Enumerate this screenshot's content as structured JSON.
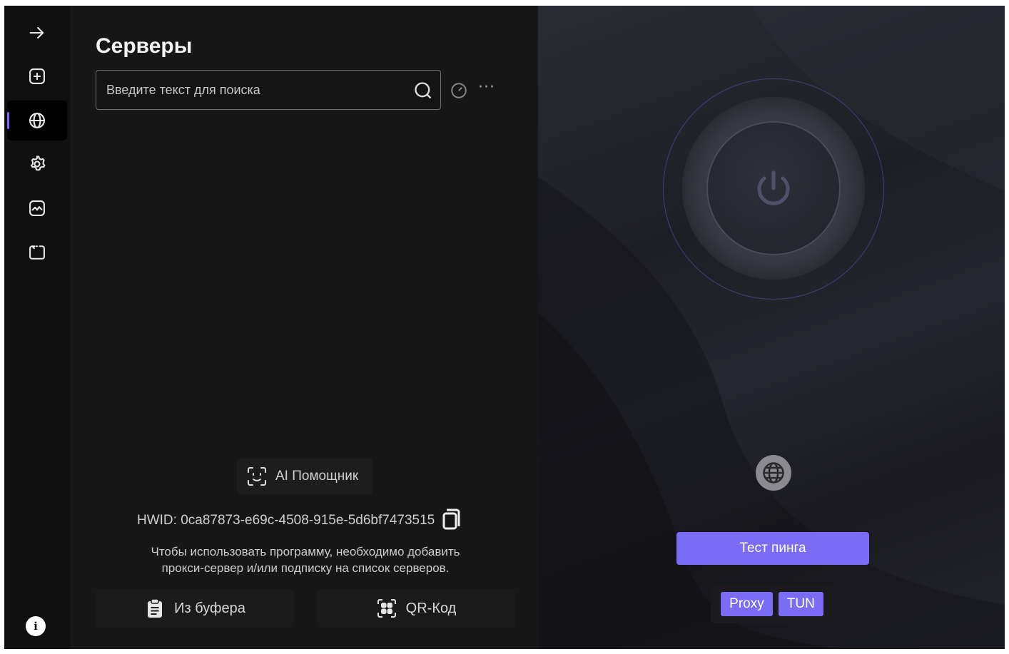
{
  "sidebar": {
    "items": [
      {
        "name": "collapse",
        "icon": "arrow-right-icon"
      },
      {
        "name": "add",
        "icon": "add-square-icon"
      },
      {
        "name": "servers",
        "icon": "globe-icon",
        "active": true
      },
      {
        "name": "settings",
        "icon": "gear-icon"
      },
      {
        "name": "stats",
        "icon": "chart-icon"
      },
      {
        "name": "logs",
        "icon": "terminal-icon"
      }
    ],
    "info_icon_glyph": "i"
  },
  "main": {
    "title": "Серверы",
    "search": {
      "placeholder": "Введите текст для поиска",
      "value": ""
    },
    "more_label": "···",
    "ai_button_label": "AI Помощник",
    "hwid": "HWID: 0ca87873-e69c-4508-915e-5d6bf7473515",
    "hint_line1": "Чтобы использовать программу, необходимо добавить",
    "hint_line2": "прокси-сервер и/или подписку на список серверов.",
    "clipboard_button_label": "Из буфера",
    "qr_button_label": "QR-Код"
  },
  "connection": {
    "ping_button_label": "Тест пинга",
    "modes": [
      "Proxy",
      "TUN"
    ]
  },
  "colors": {
    "accent": "#7b6cf6",
    "background": "#151515",
    "sidebar": "#101010"
  }
}
